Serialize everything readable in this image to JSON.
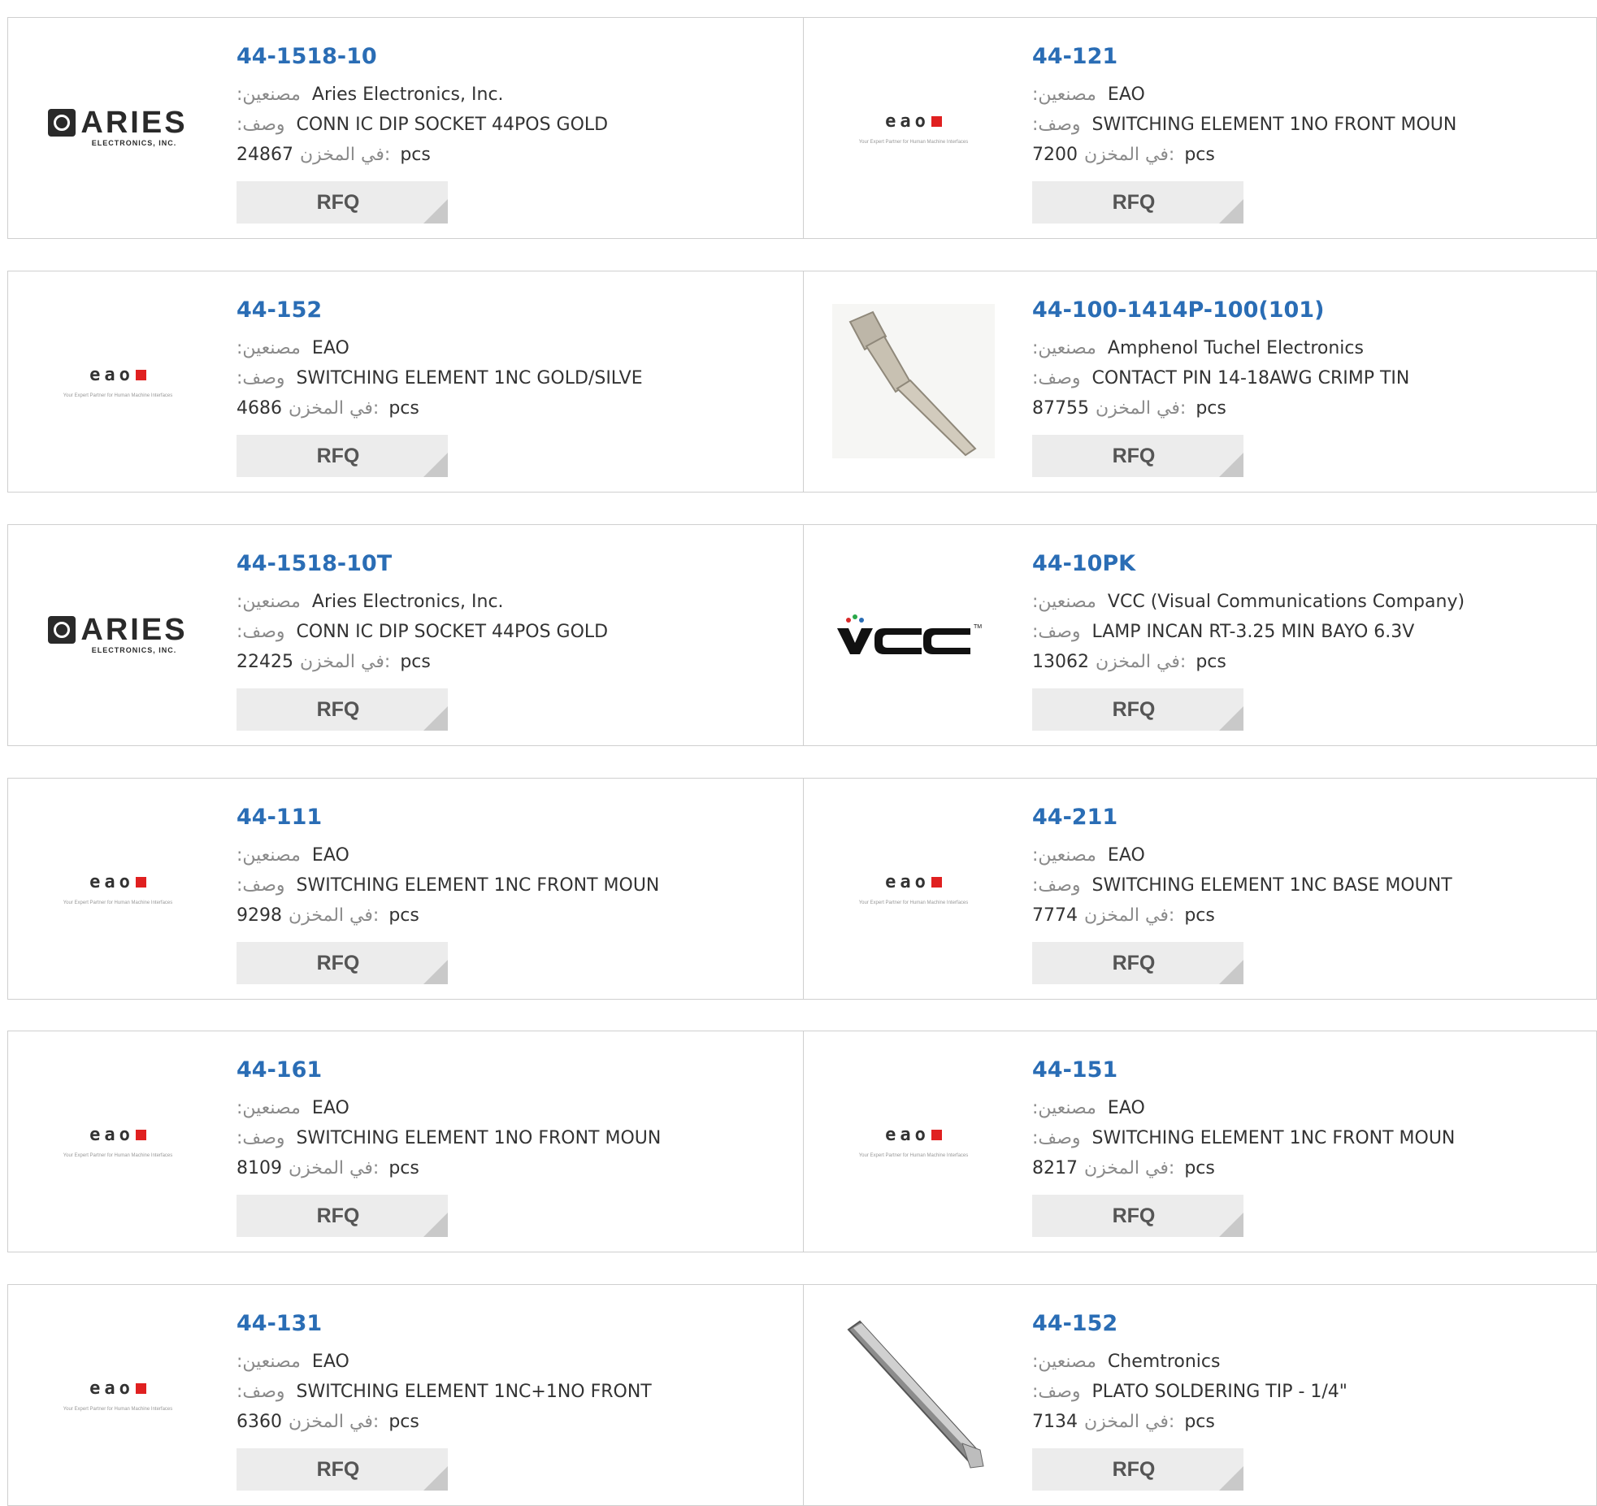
{
  "labels": {
    "manufacturer": ":مصنعين",
    "description": ":وصف",
    "stock": "في المخزن:",
    "unit": "pcs",
    "rfq": "RFQ"
  },
  "logos": {
    "aries": {
      "word": "ARIES",
      "sub": "ELECTRONICS, INC."
    },
    "eao": {
      "word": "eao",
      "tagline": "Your Expert Partner for Human Machine Interfaces"
    },
    "vcc": {
      "word": "VCC"
    }
  },
  "colors": {
    "part_link": "#2a6db5",
    "label_gray": "#8a8a8a",
    "button_bg": "#ececec",
    "eao_red": "#e02020"
  },
  "products": [
    {
      "part": "44-1518-10",
      "manufacturer": "Aries Electronics, Inc.",
      "description": "CONN IC DIP SOCKET 44POS GOLD",
      "stock": "24867",
      "logo": "aries"
    },
    {
      "part": "44-121",
      "manufacturer": "EAO",
      "description": "SWITCHING ELEMENT 1NO FRONT MOUN",
      "stock": "7200",
      "logo": "eao"
    },
    {
      "part": "44-152",
      "manufacturer": "EAO",
      "description": "SWITCHING ELEMENT 1NC GOLD/SILVE",
      "stock": "4686",
      "logo": "eao"
    },
    {
      "part": "44-100-1414P-100(101)",
      "manufacturer": "Amphenol Tuchel Electronics",
      "description": "CONTACT PIN 14-18AWG CRIMP TIN",
      "stock": "87755",
      "logo": "contact-pin-photo"
    },
    {
      "part": "44-1518-10T",
      "manufacturer": "Aries Electronics, Inc.",
      "description": "CONN IC DIP SOCKET 44POS GOLD",
      "stock": "22425",
      "logo": "aries"
    },
    {
      "part": "44-10PK",
      "manufacturer": "VCC (Visual Communications Company)",
      "description": "LAMP INCAN RT-3.25 MIN BAYO 6.3V",
      "stock": "13062",
      "logo": "vcc"
    },
    {
      "part": "44-111",
      "manufacturer": "EAO",
      "description": "SWITCHING ELEMENT 1NC FRONT MOUN",
      "stock": "9298",
      "logo": "eao"
    },
    {
      "part": "44-211",
      "manufacturer": "EAO",
      "description": "SWITCHING ELEMENT 1NC BASE MOUNT",
      "stock": "7774",
      "logo": "eao"
    },
    {
      "part": "44-161",
      "manufacturer": "EAO",
      "description": "SWITCHING ELEMENT 1NO FRONT MOUN",
      "stock": "8109",
      "logo": "eao"
    },
    {
      "part": "44-151",
      "manufacturer": "EAO",
      "description": "SWITCHING ELEMENT 1NC FRONT MOUN",
      "stock": "8217",
      "logo": "eao"
    },
    {
      "part": "44-131",
      "manufacturer": "EAO",
      "description": "SWITCHING ELEMENT 1NC+1NO FRONT",
      "stock": "6360",
      "logo": "eao"
    },
    {
      "part": "44-152",
      "manufacturer": "Chemtronics",
      "description": "PLATO SOLDERING TIP - 1/4\"",
      "stock": "7134",
      "logo": "soldering-tip-photo"
    }
  ]
}
